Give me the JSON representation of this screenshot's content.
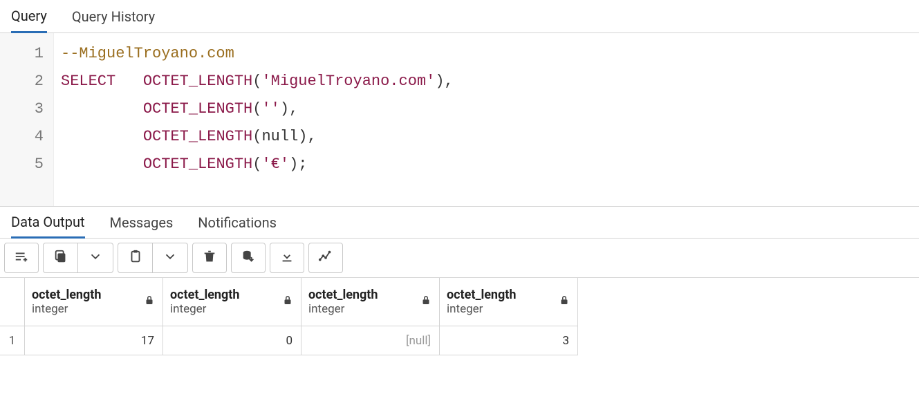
{
  "top_tabs": {
    "query": "Query",
    "history": "Query History"
  },
  "editor": {
    "line_numbers": [
      "1",
      "2",
      "3",
      "4",
      "5"
    ],
    "l1_comment": "--MiguelTroyano.com",
    "l2_select": "SELECT",
    "func": "OCTET_LENGTH",
    "l2_arg": "'MiguelTroyano.com'",
    "l3_arg": "''",
    "l4_arg": "null",
    "l5_arg": "'€'"
  },
  "output_tabs": {
    "data_output": "Data Output",
    "messages": "Messages",
    "notifications": "Notifications"
  },
  "columns": [
    {
      "name": "octet_length",
      "type": "integer"
    },
    {
      "name": "octet_length",
      "type": "integer"
    },
    {
      "name": "octet_length",
      "type": "integer"
    },
    {
      "name": "octet_length",
      "type": "integer"
    }
  ],
  "rows": [
    {
      "num": "1",
      "cells": [
        "17",
        "0",
        "[null]",
        "3"
      ],
      "null_flags": [
        false,
        false,
        true,
        false
      ]
    }
  ],
  "icons": {
    "add_row": "add-row-icon",
    "copy": "copy-icon",
    "chevron": "chevron-down-icon",
    "paste": "paste-icon",
    "trash": "trash-icon",
    "save_db": "save-data-icon",
    "download": "download-icon",
    "chart": "chart-icon",
    "lock": "lock-icon"
  }
}
